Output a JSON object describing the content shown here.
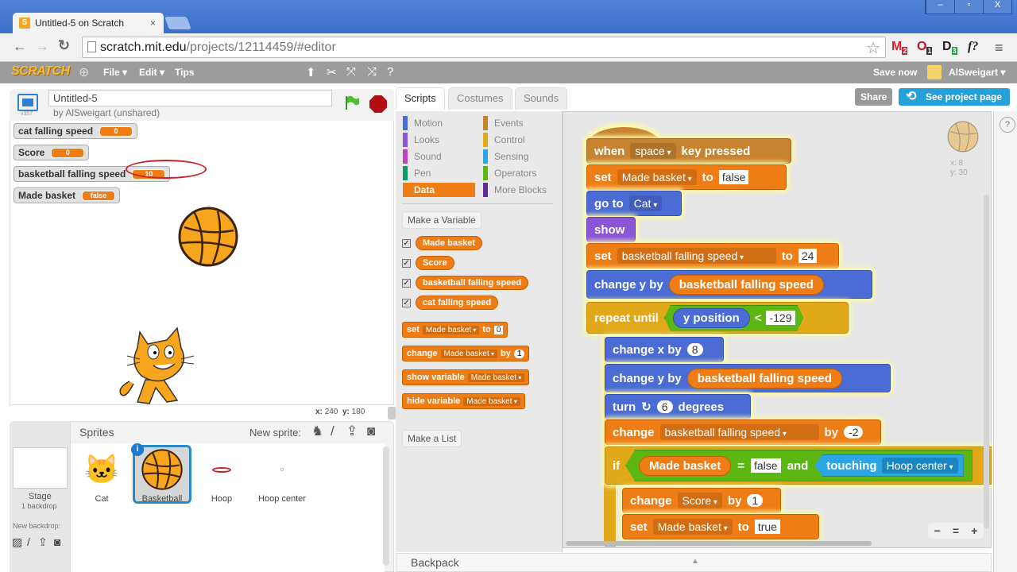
{
  "browser": {
    "tab_title": "Untitled-5 on Scratch",
    "tab_close": "×",
    "url_domain": "scratch.mit.edu",
    "url_path": "/projects/12114459/#editor",
    "window_controls": [
      "–",
      "▫",
      "X"
    ],
    "extensions": [
      {
        "name": "gmail",
        "glyph": "M",
        "badge": "2",
        "color": "#d2232a"
      },
      {
        "name": "opera-like",
        "glyph": "O",
        "badge": "1",
        "color": "#c8102e"
      },
      {
        "name": "d-ext",
        "glyph": "D",
        "badge": "3",
        "color": "#222222"
      },
      {
        "name": "f-ext",
        "glyph": "f?",
        "badge": "",
        "color": "#222222"
      }
    ]
  },
  "scratch_header": {
    "logo": "SCRATCH",
    "menus": [
      "File ▾",
      "Edit ▾",
      "Tips"
    ],
    "save_now": "Save now",
    "user": "AlSweigart ▾"
  },
  "project": {
    "title": "Untitled-5",
    "byline": "by AlSweigart (unshared)",
    "version": "v357",
    "share_label": "Share",
    "see_project_label": "See project page"
  },
  "monitors": [
    {
      "label": "cat falling speed",
      "value": "0"
    },
    {
      "label": "Score",
      "value": "0"
    },
    {
      "label": "basketball falling speed",
      "value": "10"
    },
    {
      "label": "Made basket",
      "value": "false"
    }
  ],
  "stage": {
    "mouse_x_label": "x:",
    "mouse_x": "240",
    "mouse_y_label": "y:",
    "mouse_y": "180"
  },
  "sprites_pane": {
    "title": "Sprites",
    "new_sprite": "New sprite:",
    "stage_label": "Stage",
    "stage_sub": "1 backdrop",
    "new_backdrop": "New backdrop:",
    "sprites": [
      {
        "name": "Cat",
        "selected": false
      },
      {
        "name": "Basketball",
        "selected": true
      },
      {
        "name": "Hoop",
        "selected": false
      },
      {
        "name": "Hoop center",
        "selected": false
      }
    ]
  },
  "editor_tabs": [
    "Scripts",
    "Costumes",
    "Sounds"
  ],
  "categories": [
    {
      "label": "Motion",
      "color": "#4a6cd4"
    },
    {
      "label": "Events",
      "color": "#c88330"
    },
    {
      "label": "Looks",
      "color": "#8a55d7"
    },
    {
      "label": "Control",
      "color": "#e1a91a"
    },
    {
      "label": "Sound",
      "color": "#bb42c3"
    },
    {
      "label": "Sensing",
      "color": "#2ca5e2"
    },
    {
      "label": "Pen",
      "color": "#0e9a6c"
    },
    {
      "label": "Operators",
      "color": "#5cb712"
    },
    {
      "label": "Data",
      "color": "#ee7d16",
      "selected": true
    },
    {
      "label": "More Blocks",
      "color": "#632d99"
    }
  ],
  "palette": {
    "make_variable": "Make a Variable",
    "make_list": "Make a List",
    "variables": [
      "Made basket",
      "Score",
      "basketball falling speed",
      "cat falling speed"
    ],
    "blocks": {
      "set": {
        "kw": "set",
        "var": "Made basket",
        "to": "to",
        "val": "0"
      },
      "change": {
        "kw": "change",
        "var": "Made basket",
        "by": "by",
        "val": "1"
      },
      "show": {
        "kw": "show variable",
        "var": "Made basket"
      },
      "hide": {
        "kw": "hide variable",
        "var": "Made basket"
      }
    }
  },
  "script": {
    "b1": {
      "a": "when",
      "dd": "space",
      "b": "key pressed"
    },
    "b2": {
      "a": "set",
      "dd": "Made basket",
      "b": "to",
      "val": "false"
    },
    "b3": {
      "a": "go to",
      "dd": "Cat"
    },
    "b4": {
      "a": "show"
    },
    "b5": {
      "a": "set",
      "dd": "basketball falling speed",
      "b": "to",
      "val": "24"
    },
    "b6": {
      "a": "change y by",
      "rep": "basketball falling speed"
    },
    "b7": {
      "a": "repeat until",
      "rep": "y position",
      "op": "<",
      "val": "-129"
    },
    "b8": {
      "a": "change x by",
      "val": "8"
    },
    "b9": {
      "a": "change y by",
      "rep": "basketball falling speed"
    },
    "b10": {
      "a": "turn",
      "icon": "↻",
      "val": "6",
      "b": "degrees"
    },
    "b11": {
      "a": "change",
      "dd": "basketball falling speed",
      "b": "by",
      "val": "-2"
    },
    "b12": {
      "a": "if",
      "rep": "Made basket",
      "op": "=",
      "val": "false",
      "and": "and",
      "touch": "touching",
      "touchdd": "Hoop center"
    },
    "b13": {
      "a": "change",
      "dd": "Score",
      "b": "by",
      "val": "1"
    },
    "b14": {
      "a": "set",
      "dd": "Made basket",
      "b": "to",
      "val": "true"
    }
  },
  "sprite_info": {
    "x": "x: 8",
    "y": "y: 30"
  },
  "zoom_controls": [
    "−",
    "=",
    "+"
  ],
  "backpack": "Backpack"
}
